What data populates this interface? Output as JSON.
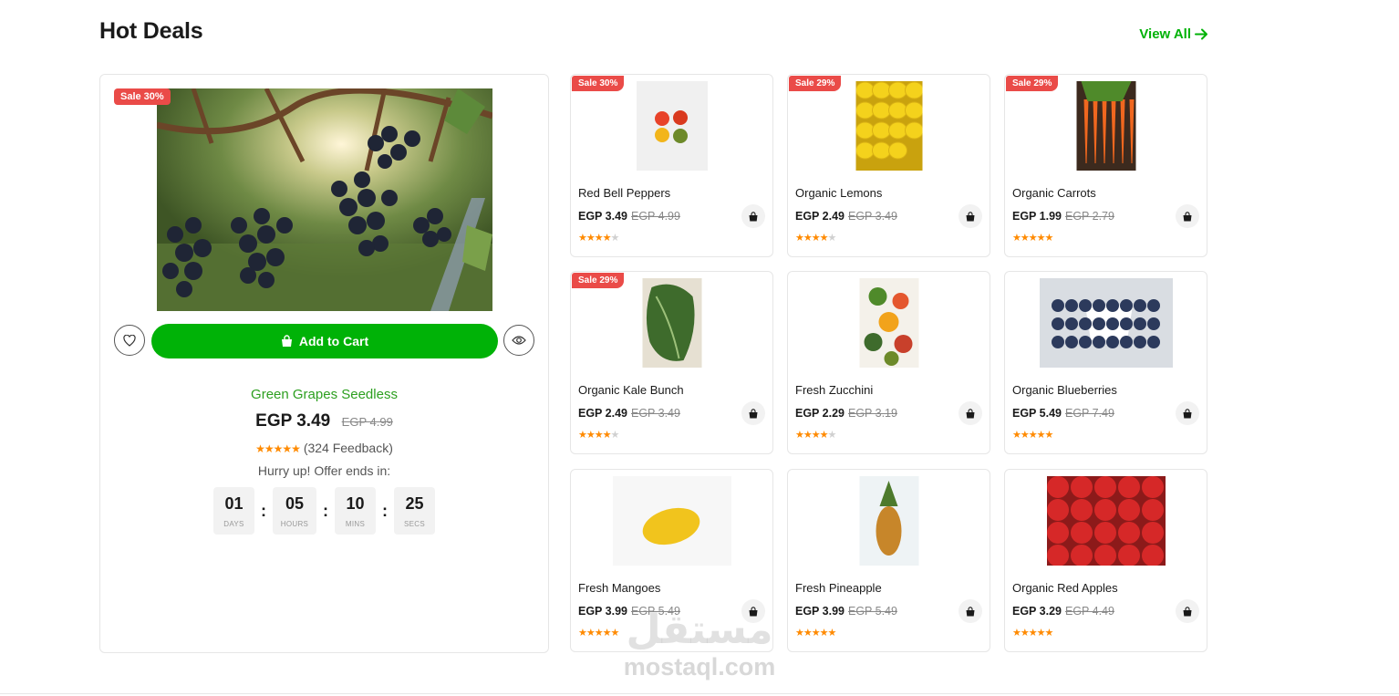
{
  "section": {
    "title": "Hot Deals",
    "view_all": "View All"
  },
  "featured": {
    "sale_badge": "Sale 30%",
    "image_icon": "grapes-photo",
    "cart_label": "Add to Cart",
    "name": "Green Grapes Seedless",
    "price": "EGP 3.49",
    "old_price": "EGP 4.99",
    "rating": 5,
    "feedback": "(324 Feedback)",
    "hurry_text": "Hurry up! Offer ends in:",
    "countdown": [
      {
        "value": "01",
        "label": "DAYS"
      },
      {
        "value": "05",
        "label": "HOURS"
      },
      {
        "value": "10",
        "label": "MINS"
      },
      {
        "value": "25",
        "label": "SECS"
      }
    ]
  },
  "products": [
    {
      "name": "Red Bell Peppers",
      "price": "EGP 3.49",
      "old_price": "EGP 4.99",
      "rating": 4,
      "sale": "Sale 30%",
      "image": "peppers"
    },
    {
      "name": "Organic Lemons",
      "price": "EGP 2.49",
      "old_price": "EGP 3.49",
      "rating": 4,
      "sale": "Sale 29%",
      "image": "lemons"
    },
    {
      "name": "Organic Carrots",
      "price": "EGP 1.99",
      "old_price": "EGP 2.79",
      "rating": 5,
      "sale": "Sale 29%",
      "image": "carrots"
    },
    {
      "name": "Organic Kale Bunch",
      "price": "EGP 2.49",
      "old_price": "EGP 3.49",
      "rating": 4,
      "sale": "Sale 29%",
      "image": "kale"
    },
    {
      "name": "Fresh Zucchini",
      "price": "EGP 2.29",
      "old_price": "EGP 3.19",
      "rating": 4,
      "sale": "",
      "image": "vegetables"
    },
    {
      "name": "Organic Blueberries",
      "price": "EGP 5.49",
      "old_price": "EGP 7.49",
      "rating": 5,
      "sale": "",
      "image": "blueberries"
    },
    {
      "name": "Fresh Mangoes",
      "price": "EGP 3.99",
      "old_price": "EGP 5.49",
      "rating": 5,
      "sale": "",
      "image": "mango"
    },
    {
      "name": "Fresh Pineapple",
      "price": "EGP 3.99",
      "old_price": "EGP 5.49",
      "rating": 5,
      "sale": "",
      "image": "pineapple"
    },
    {
      "name": "Organic Red Apples",
      "price": "EGP 3.29",
      "old_price": "EGP 4.49",
      "rating": 5,
      "sale": "",
      "image": "apples"
    }
  ],
  "watermark": {
    "logo": "مستقل",
    "text": "mostaql.com"
  },
  "colors": {
    "accent": "#00b207",
    "sale": "#ea4b48",
    "star": "#ff8a00",
    "name_green": "#2c9f1f"
  }
}
